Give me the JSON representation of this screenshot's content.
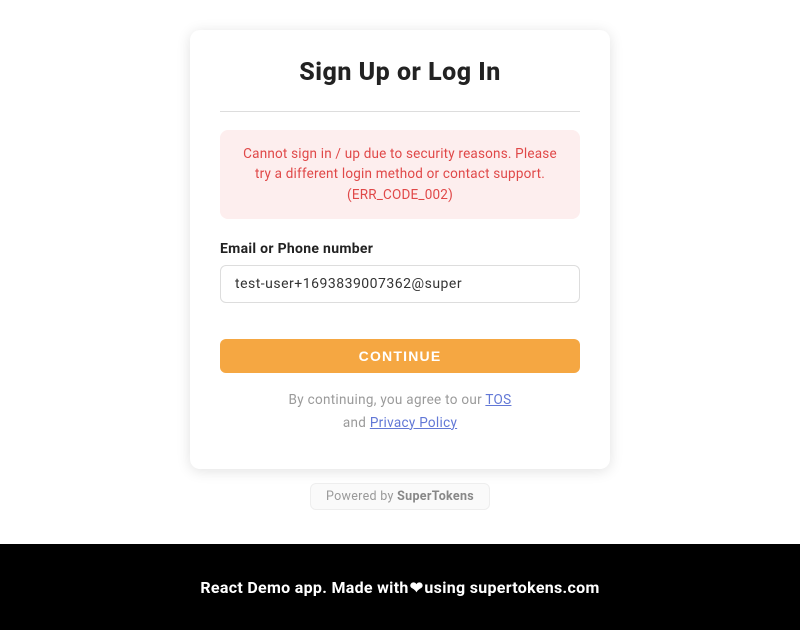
{
  "card": {
    "title": "Sign Up or Log In",
    "error": "Cannot sign in / up due to security reasons. Please try a different login method or contact support. (ERR_CODE_002)",
    "field_label": "Email or Phone number",
    "input_value": "test-user+1693839007362@super",
    "button_label": "CONTINUE",
    "terms_prefix": "By continuing, you agree to our ",
    "tos_label": "TOS",
    "terms_middle": " and ",
    "privacy_label": "Privacy Policy"
  },
  "powered": {
    "prefix": "Powered by ",
    "brand": "SuperTokens"
  },
  "footer": {
    "text_prefix": "React Demo app. Made with",
    "heart": "❤",
    "text_suffix": "using supertokens.com"
  }
}
